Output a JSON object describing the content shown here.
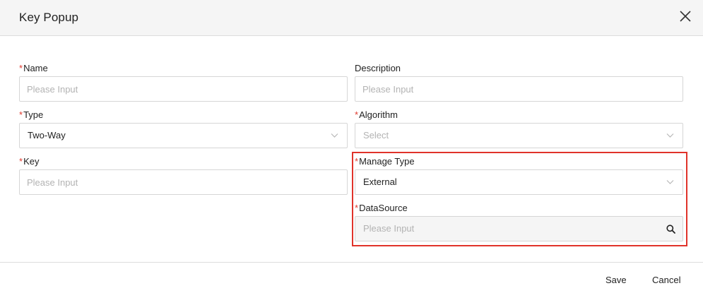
{
  "dialog": {
    "title": "Key Popup",
    "close_icon": "close-icon"
  },
  "form": {
    "required_mark": "*",
    "name": {
      "label": "Name",
      "placeholder": "Please Input",
      "required": true
    },
    "description": {
      "label": "Description",
      "placeholder": "Please Input",
      "required": false
    },
    "type": {
      "label": "Type",
      "value": "Two-Way",
      "required": true
    },
    "algorithm": {
      "label": "Algorithm",
      "placeholder": "Select",
      "required": true
    },
    "key": {
      "label": "Key",
      "placeholder": "Please Input",
      "required": true
    },
    "manage_type": {
      "label": "Manage Type",
      "value": "External",
      "required": true
    },
    "datasource": {
      "label": "DataSource",
      "placeholder": "Please Input",
      "required": true,
      "icon": "search-icon"
    }
  },
  "footer": {
    "save_label": "Save",
    "cancel_label": "Cancel"
  },
  "colors": {
    "required": "#e03a2f",
    "highlight": "#e0332a",
    "header_bg": "#f5f5f5"
  }
}
